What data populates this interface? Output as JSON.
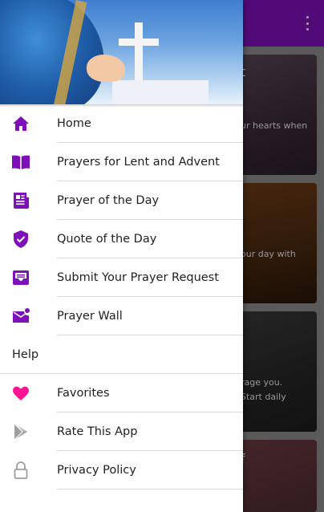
{
  "background": {
    "card_snippets": [
      {
        "title_fragment": "t",
        "text": "ur hearts when"
      },
      {
        "title_fragment": "",
        "text": "our day with"
      },
      {
        "title_fragment": "",
        "text": "rage you. Start daily"
      },
      {
        "title_fragment": "f",
        "text": ""
      }
    ]
  },
  "drawer": {
    "items": [
      {
        "label": "Home",
        "icon": "home-icon"
      },
      {
        "label": "Prayers for Lent and Advent",
        "icon": "book-icon"
      },
      {
        "label": "Prayer of the Day",
        "icon": "newspaper-icon"
      },
      {
        "label": "Quote of the Day",
        "icon": "shield-check-icon"
      },
      {
        "label": "Submit Your Prayer Request",
        "icon": "inbox-icon"
      },
      {
        "label": "Prayer Wall",
        "icon": "mail-notification-icon"
      }
    ],
    "help_section": "Help",
    "help_items": [
      {
        "label": "Favorites",
        "icon": "heart-icon"
      },
      {
        "label": "Rate This App",
        "icon": "play-store-icon"
      },
      {
        "label": "Privacy Policy",
        "icon": "lock-icon"
      }
    ]
  },
  "colors": {
    "accent": "#7d10b8",
    "favorite": "#ff1493",
    "muted_icon": "#9e9e9e"
  }
}
